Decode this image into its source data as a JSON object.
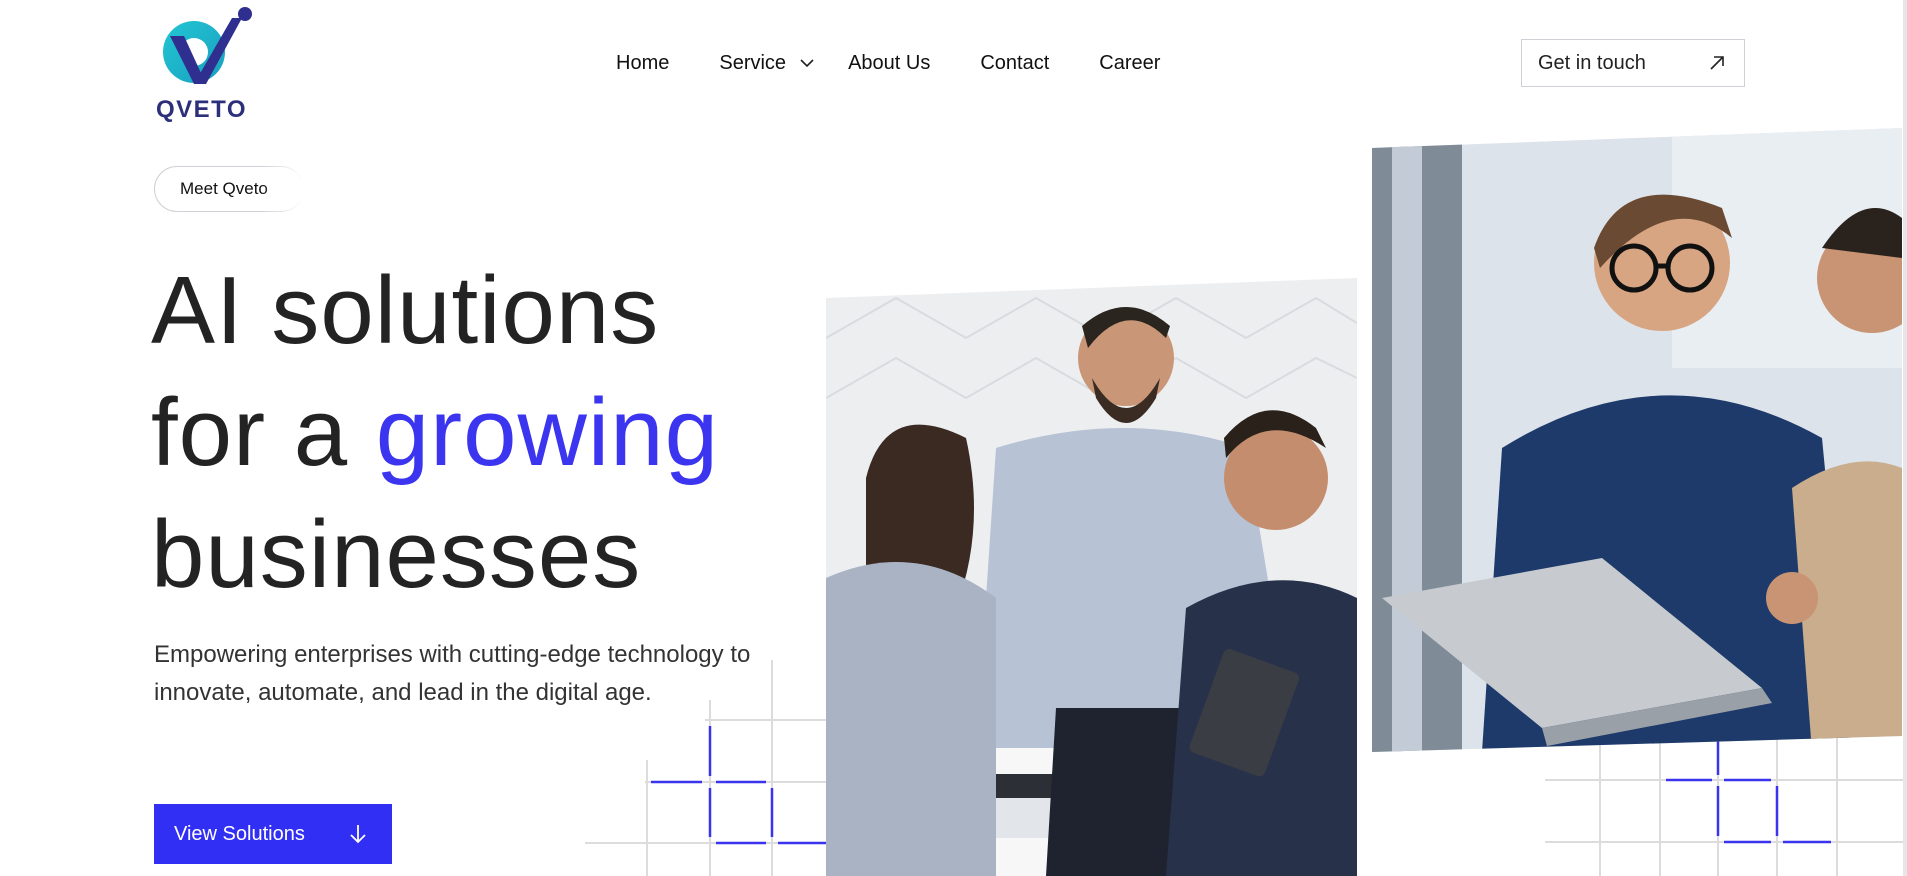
{
  "brand": {
    "name": "QVETO"
  },
  "nav": {
    "items": [
      {
        "label": "Home"
      },
      {
        "label": "Service"
      },
      {
        "label": "About Us"
      },
      {
        "label": "Contact"
      },
      {
        "label": "Career"
      }
    ],
    "cta_label": "Get in touch"
  },
  "hero": {
    "pill_label": "Meet Qveto",
    "headline_line1": "AI solutions",
    "headline_line2_prefix": "for a ",
    "headline_accent": "growing",
    "headline_line3": "businesses",
    "subtext": "Empowering enterprises with cutting-edge technology to innovate, automate, and lead in the digital age.",
    "button_label": "View Solutions"
  },
  "colors": {
    "accent": "#322ff5",
    "headline_accent": "#3c35f0",
    "brand_dark": "#2d2f7a",
    "brand_teal": "#1cb8c9"
  },
  "icons": {
    "service_dropdown": "chevron-down-icon",
    "cta": "arrow-up-right-icon",
    "view_solutions": "arrow-down-icon"
  }
}
